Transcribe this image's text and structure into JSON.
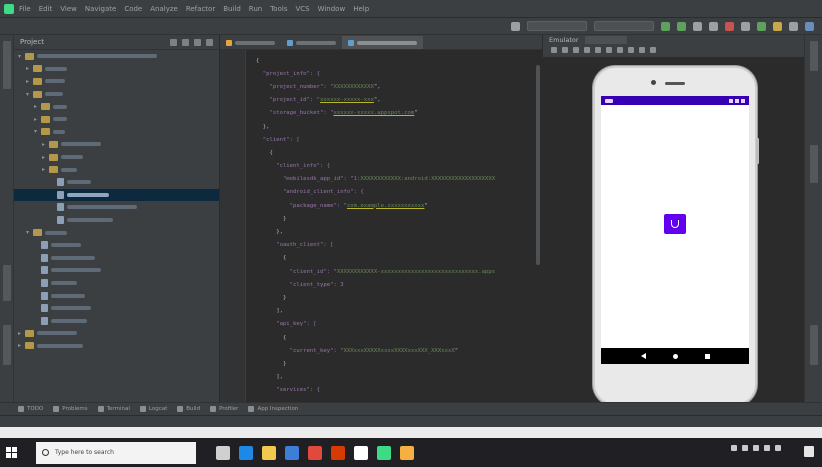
{
  "menubar": {
    "items": [
      "File",
      "Edit",
      "View",
      "Navigate",
      "Code",
      "Analyze",
      "Refactor",
      "Build",
      "Run",
      "Tools",
      "VCS",
      "Window",
      "Help"
    ]
  },
  "toolbar": {
    "breadcrumb": "",
    "device_selector": ""
  },
  "project_panel": {
    "header_label": "Project"
  },
  "editor": {
    "tabs": [
      {
        "label": "",
        "active": false
      },
      {
        "label": "",
        "active": false
      },
      {
        "label": "",
        "active": true
      }
    ],
    "code_lines": [
      [
        {
          "t": "{",
          "c": "p"
        }
      ],
      [
        {
          "t": "  \"project_info\": {",
          "c": "k"
        }
      ],
      [
        {
          "t": "    \"project_number\": \"",
          "c": "k"
        },
        {
          "t": "XXXXXXXXXXXX",
          "c": "s"
        },
        {
          "t": "\",",
          "c": "p"
        }
      ],
      [
        {
          "t": "    \"project_id\": \"",
          "c": "k"
        },
        {
          "t": "xxxxxx-xxxxx-xxx",
          "c": "u"
        },
        {
          "t": "\",",
          "c": "p"
        }
      ],
      [
        {
          "t": "    \"storage_bucket\": \"",
          "c": "k"
        },
        {
          "t": "xxxxxx-xxxxx.appspot.com",
          "c": "u"
        },
        {
          "t": "\"",
          "c": "p"
        }
      ],
      [
        {
          "t": "  },",
          "c": "p"
        }
      ],
      [
        {
          "t": "  \"client\": [",
          "c": "k"
        }
      ],
      [
        {
          "t": "    {",
          "c": "p"
        }
      ],
      [
        {
          "t": "      \"client_info\": {",
          "c": "k"
        }
      ],
      [
        {
          "t": "        \"mobilesdk_app_id\": \"",
          "c": "k"
        },
        {
          "t": "1:XXXXXXXXXXXX:android:XXXXXXXXXXXXXXXXXXX",
          "c": "s"
        }
      ],
      [
        {
          "t": "        \"android_client_info\": {",
          "c": "k"
        }
      ],
      [
        {
          "t": "          \"package_name\": \"",
          "c": "k"
        },
        {
          "t": "com.example.xxxxxxxxxxx",
          "c": "u"
        },
        {
          "t": "\"",
          "c": "p"
        }
      ],
      [
        {
          "t": "        }",
          "c": "p"
        }
      ],
      [
        {
          "t": "      },",
          "c": "p"
        }
      ],
      [
        {
          "t": "      \"oauth_client\": [",
          "c": "k"
        }
      ],
      [
        {
          "t": "        {",
          "c": "p"
        }
      ],
      [
        {
          "t": "          \"client_id\": \"",
          "c": "k"
        },
        {
          "t": "XXXXXXXXXXXX-xxxxxxxxxxxxxxxxxxxxxxxxxxxxx.apps",
          "c": "s"
        }
      ],
      [
        {
          "t": "          \"client_type\": 3",
          "c": "k"
        }
      ],
      [
        {
          "t": "        }",
          "c": "p"
        }
      ],
      [
        {
          "t": "      ],",
          "c": "p"
        }
      ],
      [
        {
          "t": "      \"api_key\": [",
          "c": "k"
        }
      ],
      [
        {
          "t": "        {",
          "c": "p"
        }
      ],
      [
        {
          "t": "          \"current_key\": \"",
          "c": "k"
        },
        {
          "t": "XXXxxxXXXXXxxxxXXXXxxxXXX_XXXxxxX",
          "c": "s"
        },
        {
          "t": "\"",
          "c": "p"
        }
      ],
      [
        {
          "t": "        }",
          "c": "p"
        }
      ],
      [
        {
          "t": "      ],",
          "c": "p"
        }
      ],
      [
        {
          "t": "      \"services\": {",
          "c": "k"
        }
      ]
    ]
  },
  "emulator": {
    "panel_label": "Emulator",
    "device_label": ""
  },
  "bottom_tools": {
    "items": [
      "TODO",
      "Problems",
      "Terminal",
      "Logcat",
      "Build",
      "Profiler",
      "App Inspection"
    ]
  },
  "status_line": {
    "message": "",
    "right_items": [
      "",
      "",
      ""
    ]
  },
  "taskbar": {
    "search_placeholder": "Type here to search",
    "time": "",
    "date": "",
    "icons": [
      {
        "name": "task-view-icon",
        "color": "#d0d0d0"
      },
      {
        "name": "edge-icon",
        "color": "#1e88e5"
      },
      {
        "name": "file-explorer-icon",
        "color": "#f2c94c"
      },
      {
        "name": "store-icon",
        "color": "#3d7fd8"
      },
      {
        "name": "mail-icon",
        "color": "#e04a3c"
      },
      {
        "name": "office-icon",
        "color": "#d83b01"
      },
      {
        "name": "chrome-icon",
        "color": "#ffffff"
      },
      {
        "name": "android-studio-icon",
        "color": "#3ddc84"
      },
      {
        "name": "folder-icon",
        "color": "#f5b041"
      }
    ]
  },
  "colors": {
    "ide_background": "#2b2b2b",
    "panel_background": "#3c3f41",
    "phone_status_bar": "#3700b3",
    "app_icon": "#6200ee"
  }
}
